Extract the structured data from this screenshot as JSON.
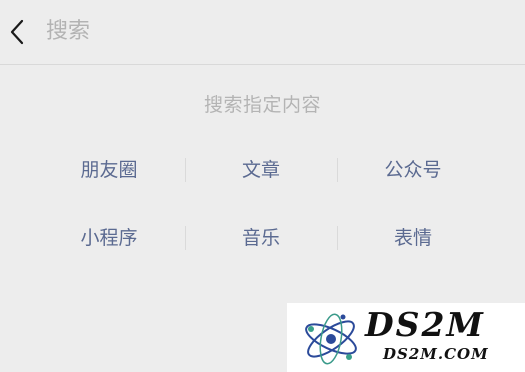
{
  "search": {
    "placeholder": "搜索",
    "value": ""
  },
  "section_title": "搜索指定内容",
  "categories": [
    {
      "label": "朋友圈"
    },
    {
      "label": "文章"
    },
    {
      "label": "公众号"
    },
    {
      "label": "小程序"
    },
    {
      "label": "音乐"
    },
    {
      "label": "表情"
    }
  ],
  "watermark": {
    "title": "DS2M",
    "url": "DS2M.COM"
  },
  "colors": {
    "background": "#ededed",
    "link": "#5b6a91",
    "hint": "#b4b4b4"
  }
}
